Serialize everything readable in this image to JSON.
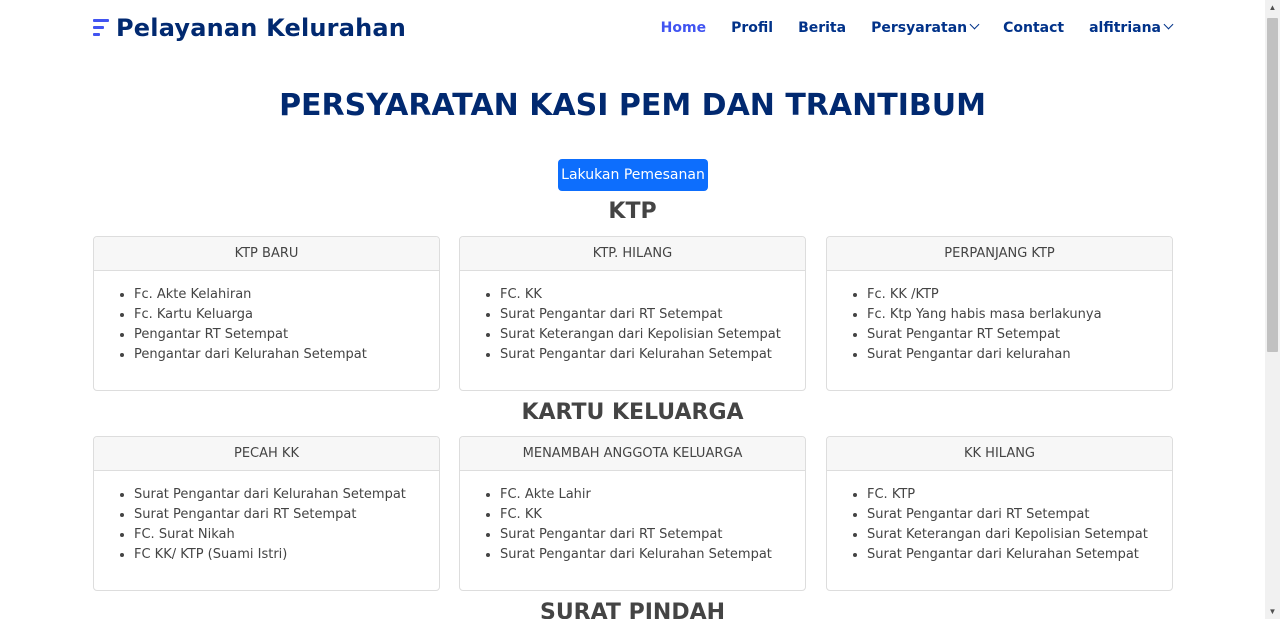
{
  "header": {
    "logo_text": "Pelayanan Kelurahan",
    "nav": [
      {
        "label": "Home"
      },
      {
        "label": "Profil"
      },
      {
        "label": "Berita"
      },
      {
        "label": "Persyaratan"
      },
      {
        "label": "Contact"
      },
      {
        "label": "alfitriana"
      }
    ]
  },
  "main": {
    "title": "PERSYARATAN KASI PEM DAN TRANTIBUM",
    "order_button": "Lakukan Pemesanan",
    "sections": [
      {
        "title": "KTP",
        "cards": [
          {
            "header": "KTP BARU",
            "items": [
              "Fc. Akte Kelahiran",
              "Fc. Kartu Keluarga",
              "Pengantar RT Setempat",
              "Pengantar dari Kelurahan Setempat"
            ]
          },
          {
            "header": "KTP. HILANG",
            "items": [
              "FC. KK",
              "Surat Pengantar dari RT Setempat",
              "Surat Keterangan dari Kepolisian Setempat",
              "Surat Pengantar dari Kelurahan Setempat"
            ]
          },
          {
            "header": "PERPANJANG KTP",
            "items": [
              "Fc. KK /KTP",
              "Fc. Ktp Yang habis masa berlakunya",
              "Surat Pengantar RT Setempat",
              "Surat Pengantar dari kelurahan"
            ]
          }
        ]
      },
      {
        "title": "KARTU KELUARGA",
        "cards": [
          {
            "header": "PECAH KK",
            "items": [
              "Surat Pengantar dari Kelurahan Setempat",
              "Surat Pengantar dari RT Setempat",
              "FC. Surat Nikah",
              "FC KK/ KTP (Suami Istri)"
            ]
          },
          {
            "header": "MENAMBAH ANGGOTA KELUARGA",
            "items": [
              "FC. Akte Lahir",
              "FC. KK",
              "Surat Pengantar dari RT Setempat",
              "Surat Pengantar dari Kelurahan Setempat"
            ]
          },
          {
            "header": "KK HILANG",
            "items": [
              "FC. KTP",
              "Surat Pengantar dari RT Setempat",
              "Surat Keterangan dari Kepolisian Setempat",
              "Surat Pengantar dari Kelurahan Setempat"
            ]
          }
        ]
      },
      {
        "title": "SURAT PINDAH",
        "cards": []
      }
    ]
  },
  "colors": {
    "brand": "#012970",
    "accent": "#4154f1",
    "button": "#0d6efd"
  },
  "scrollbar": {
    "up_icon": "▲",
    "down_icon": "▼"
  }
}
